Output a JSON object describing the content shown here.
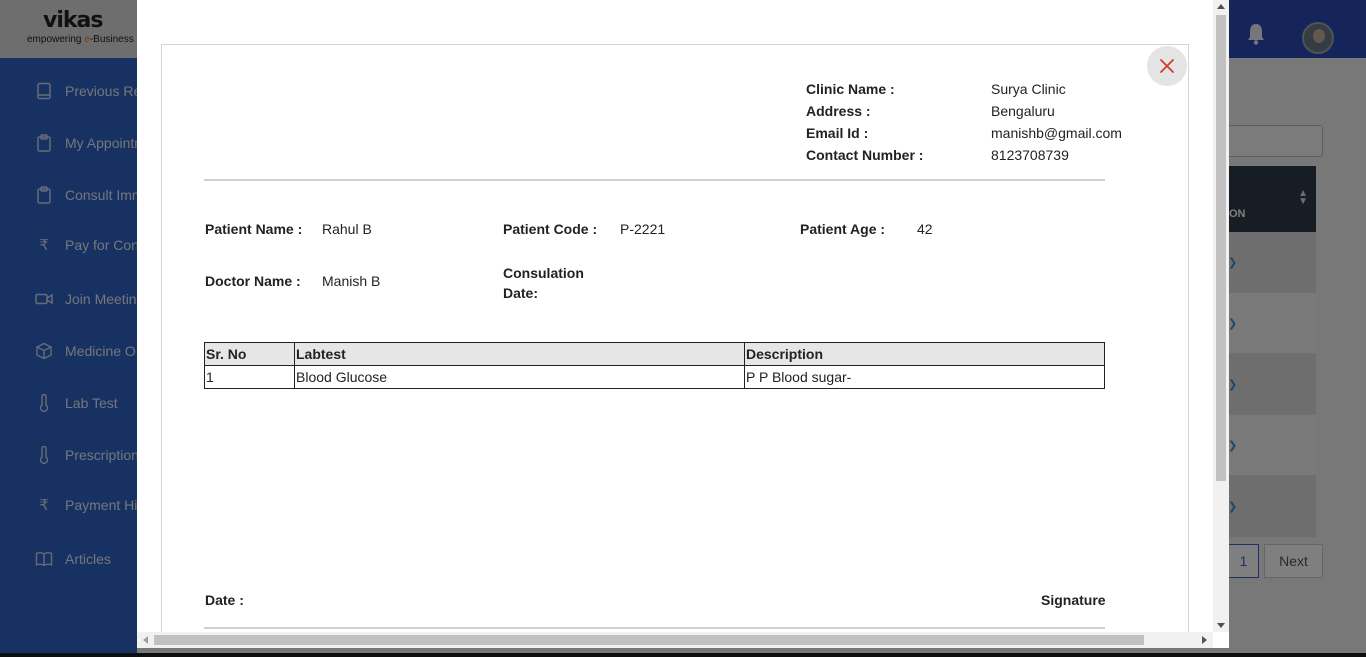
{
  "app": {
    "logo": {
      "name": "vikas",
      "tagline_pre": "empowering ",
      "tagline_e": "e",
      "tagline_post": "-Business"
    },
    "sidebar": {
      "items": [
        {
          "label": "Previous Re",
          "icon": "book-icon"
        },
        {
          "label": "My Appointm",
          "icon": "clipboard-icon"
        },
        {
          "label": "Consult Imm",
          "icon": "clipboard-icon"
        },
        {
          "label": "Pay for Con",
          "icon": "rupee-icon"
        },
        {
          "label": "Join Meetin",
          "icon": "video-icon"
        },
        {
          "label": "Medicine O",
          "icon": "box-icon"
        },
        {
          "label": "Lab Test",
          "icon": "thermometer-icon"
        },
        {
          "label": "Prescription",
          "icon": "thermometer-icon"
        },
        {
          "label": "Payment Hi",
          "icon": "rupee-icon"
        },
        {
          "label": "Articles",
          "icon": "open-book-icon"
        }
      ]
    },
    "table_peek": {
      "header_fragment": "ON"
    },
    "pagination": {
      "page": "1",
      "next": "Next"
    }
  },
  "modal": {
    "clinic": {
      "name_label": "Clinic Name :",
      "name": "Surya Clinic",
      "address_label": "Address :",
      "address": "Bengaluru",
      "email_label": "Email Id :",
      "email": "manishb@gmail.com",
      "contact_label": "Contact Number :",
      "contact": "8123708739"
    },
    "patient": {
      "name_label": "Patient Name :",
      "name": "Rahul B",
      "code_label": "Patient Code :",
      "code": "P-2221",
      "age_label": "Patient Age :",
      "age": "42",
      "doctor_label": "Doctor Name :",
      "doctor": "Manish B",
      "consult_label_1": "Consulation",
      "consult_label_2": "Date:",
      "consult_date": ""
    },
    "lab_table": {
      "headers": [
        "Sr. No",
        "Labtest",
        "Description"
      ],
      "rows": [
        [
          "1",
          "Blood Glucose",
          "P P Blood sugar-"
        ]
      ]
    },
    "footer": {
      "date_label": "Date :",
      "signature_label": "Signature"
    }
  },
  "colors": {
    "sidebar": "#2e62c4",
    "topbar": "#2b4bb8",
    "close_icon": "#d33a2c"
  }
}
